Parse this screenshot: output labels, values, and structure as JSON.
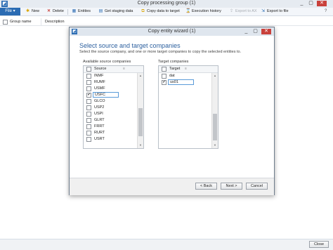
{
  "window": {
    "title": "Copy processing group (1)",
    "controls": [
      "_",
      "▢",
      "✕"
    ]
  },
  "toolbar": {
    "file": "File ▾",
    "new": "New",
    "delete": "Delete",
    "entities": "Entities",
    "get_staging": "Get staging data",
    "copy_to_target": "Copy data to target",
    "execution_history": "Execution history",
    "export_to_ax": "Export to AX",
    "export_to_file": "Export to file"
  },
  "grid": {
    "col_group_name": "Group name",
    "col_description": "Description"
  },
  "footer": {
    "close": "Close"
  },
  "dialog": {
    "title": "Copy entity wizard (1)",
    "controls": [
      "_",
      "▢",
      "✕"
    ],
    "heading": "Select source and target companies",
    "subheading": "Select the source company, and one or more target companies to copy the selected entities to.",
    "source": {
      "label": "Available source companies",
      "column": "Source",
      "rows": [
        {
          "name": "INMF",
          "checked": false
        },
        {
          "name": "RUMF",
          "checked": false
        },
        {
          "name": "USMF",
          "checked": false
        },
        {
          "name": "USFC",
          "checked": true
        },
        {
          "name": "GLCO",
          "checked": false
        },
        {
          "name": "USP2",
          "checked": false
        },
        {
          "name": "USPI",
          "checked": false
        },
        {
          "name": "GLRT",
          "checked": false
        },
        {
          "name": "FRRT",
          "checked": false
        },
        {
          "name": "RURT",
          "checked": false
        },
        {
          "name": "USRT",
          "checked": false
        }
      ]
    },
    "target": {
      "label": "Target companies",
      "column": "Target",
      "rows": [
        {
          "name": "dat",
          "checked": false
        },
        {
          "name": "us01",
          "checked": true
        }
      ]
    },
    "buttons": {
      "back": "< Back",
      "next": "Next >",
      "cancel": "Cancel"
    }
  },
  "colors": {
    "accent": "#2b6cb3",
    "heading": "#2b5f9e",
    "close": "#c9413b"
  }
}
